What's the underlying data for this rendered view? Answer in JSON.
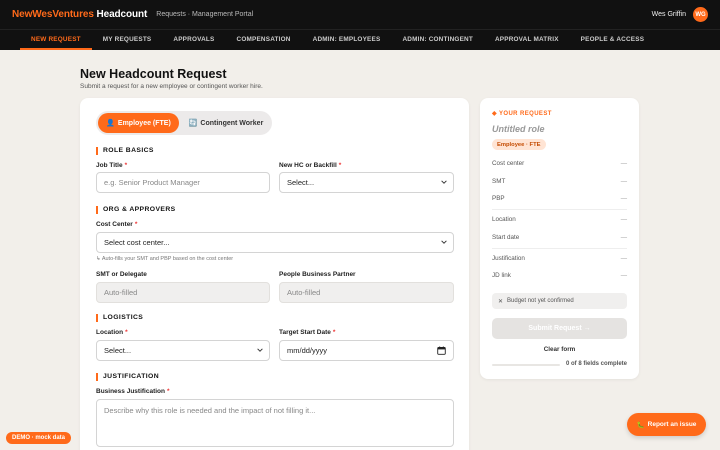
{
  "header": {
    "brand_part1": "NewWesVentures",
    "brand_part2": "Headcount",
    "portal": "Requests · Management Portal",
    "user_name": "Wes Griffin",
    "user_initials": "WG"
  },
  "nav": {
    "tabs": [
      {
        "label": "NEW REQUEST",
        "active": true
      },
      {
        "label": "MY REQUESTS"
      },
      {
        "label": "APPROVALS"
      },
      {
        "label": "COMPENSATION"
      },
      {
        "label": "ADMIN: EMPLOYEES"
      },
      {
        "label": "ADMIN: CONTINGENT"
      },
      {
        "label": "APPROVAL MATRIX"
      },
      {
        "label": "PEOPLE & ACCESS"
      }
    ]
  },
  "page": {
    "title": "New Headcount Request",
    "subtitle": "Submit a request for a new employee or contingent worker hire."
  },
  "form": {
    "type_toggle": {
      "employee": "Employee (FTE)",
      "contingent": "Contingent Worker",
      "selected": "employee"
    },
    "sections": {
      "role_basics": "ROLE BASICS",
      "org": "ORG & APPROVERS",
      "logistics": "LOGISTICS",
      "justification": "JUSTIFICATION"
    },
    "job_title": {
      "label": "Job Title",
      "placeholder": "e.g. Senior Product Manager"
    },
    "hc_type": {
      "label": "New HC or Backfill",
      "value": "Select..."
    },
    "cost_center": {
      "label": "Cost Center",
      "value": "Select cost center...",
      "hint": "↳ Auto-fills your SMT and PBP based on the cost center"
    },
    "smt": {
      "label": "SMT or Delegate",
      "value": "Auto-filled"
    },
    "pbp": {
      "label": "People Business Partner",
      "value": "Auto-filled"
    },
    "location": {
      "label": "Location",
      "value": "Select..."
    },
    "start_date": {
      "label": "Target Start Date",
      "value": "mm/dd/yyyy"
    },
    "business_justification": {
      "label": "Business Justification",
      "placeholder": "Describe why this role is needed and the impact of not filling it..."
    }
  },
  "summary": {
    "header": "YOUR REQUEST",
    "role": "Untitled role",
    "chip": "Employee · FTE",
    "rows": [
      {
        "label": "Cost center",
        "value": "—"
      },
      {
        "label": "SMT",
        "value": "—"
      },
      {
        "label": "PBP",
        "value": "—"
      },
      {
        "label": "Location",
        "value": "—"
      },
      {
        "label": "Start date",
        "value": "—"
      },
      {
        "label": "Justification",
        "value": "—"
      },
      {
        "label": "JD link",
        "value": "—"
      }
    ],
    "budget": "Budget not yet confirmed",
    "submit": "Submit Request →",
    "clear": "Clear form",
    "progress_text": "0 of 8 fields complete",
    "progress_fraction": 0
  },
  "footer": {
    "demo": "DEMO · mock data",
    "report": "Report an issue"
  },
  "colors": {
    "accent": "#ff6a1a",
    "topbar": "#111111",
    "page_bg": "#f2efea"
  }
}
